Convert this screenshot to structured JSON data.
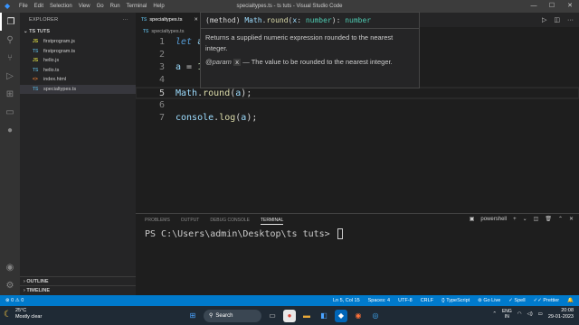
{
  "window": {
    "title": "specialtypes.ts - ts tuts - Visual Studio Code",
    "menu": [
      "File",
      "Edit",
      "Selection",
      "View",
      "Go",
      "Run",
      "Terminal",
      "Help"
    ]
  },
  "sidebar": {
    "header": "EXPLORER",
    "folder": "TS TUTS",
    "files": [
      {
        "name": "firstprogram.js",
        "icon": "JS",
        "color": "#cbcb41"
      },
      {
        "name": "firstprogram.ts",
        "icon": "TS",
        "color": "#519aba"
      },
      {
        "name": "hello.js",
        "icon": "JS",
        "color": "#cbcb41"
      },
      {
        "name": "hello.ts",
        "icon": "TS",
        "color": "#519aba"
      },
      {
        "name": "index.html",
        "icon": "<>",
        "color": "#e37933"
      },
      {
        "name": "specialtypes.ts",
        "icon": "TS",
        "color": "#519aba"
      }
    ],
    "outline": "OUTLINE",
    "timeline": "TIMELINE"
  },
  "editor": {
    "tab_label": "specialtypes.ts",
    "tab_icon": "TS",
    "breadcrumb": "specialtypes.ts",
    "lines": [
      {
        "n": "1"
      },
      {
        "n": "2"
      },
      {
        "n": "3"
      },
      {
        "n": "4"
      },
      {
        "n": "5"
      },
      {
        "n": "6"
      },
      {
        "n": "7"
      }
    ],
    "code": {
      "l1_kw": "let",
      "l1_var": "a",
      "l3_var": "a",
      "l3_op": " = ",
      "l3_num": "1",
      "l5_obj": "Math",
      "l5_fn": "round",
      "l5_arg": "a",
      "l7_obj": "console",
      "l7_fn": "log",
      "l7_arg": "a"
    }
  },
  "hover": {
    "sig_prefix": "(method) ",
    "sig_obj": "Math",
    "sig_fn": "round",
    "sig_param": "x",
    "sig_type": "number",
    "sig_ret": "number",
    "description": "Returns a supplied numeric expression rounded to the nearest integer.",
    "param_tag": "@param",
    "param_name": "x",
    "param_desc": " — The value to be rounded to the nearest integer."
  },
  "panel": {
    "tabs": [
      "PROBLEMS",
      "OUTPUT",
      "DEBUG CONSOLE",
      "TERMINAL"
    ],
    "shell": "powershell",
    "prompt": "PS C:\\Users\\admin\\Desktop\\ts tuts> "
  },
  "status": {
    "errors": "0",
    "warnings": "0",
    "position": "Ln 5, Col 15",
    "spaces": "Spaces: 4",
    "encoding": "UTF-8",
    "eol": "CRLF",
    "language": "TypeScript",
    "golive": "Go Live",
    "spell": "Spell",
    "prettier": "Prettier"
  },
  "taskbar": {
    "temp": "25°C",
    "weather": "Mostly clear",
    "search": "Search",
    "lang1": "ENG",
    "lang2": "IN",
    "time": "20:08",
    "date": "29-01-2023"
  }
}
